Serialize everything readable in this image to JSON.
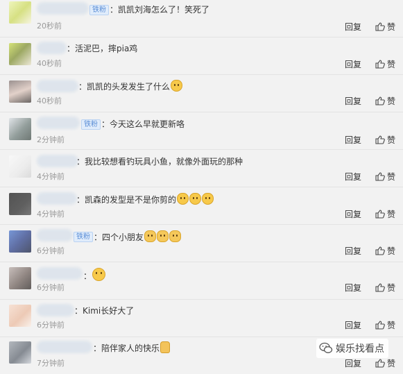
{
  "actions": {
    "reply": "回复",
    "like": "赞"
  },
  "comments": [
    {
      "badge": "铁粉",
      "text": "：凯凯刘海怎么了！笑死了",
      "emojis": [],
      "time": "20秒前"
    },
    {
      "badge": "",
      "text": "：活泥巴，摔pia鸡",
      "emojis": [],
      "time": "40秒前"
    },
    {
      "badge": "",
      "text": "：凯凯的头发发生了什么",
      "emojis": [
        "cat"
      ],
      "time": "40秒前"
    },
    {
      "badge": "铁粉",
      "text": "：今天这么早就更新咯",
      "emojis": [],
      "time": "2分钟前"
    },
    {
      "badge": "",
      "text": "：我比较想看钓玩具小鱼，就像外面玩的那种",
      "emojis": [],
      "time": "4分钟前"
    },
    {
      "badge": "",
      "text": "：凯森的发型是不是你剪的",
      "emojis": [
        "cat",
        "cat",
        "cat"
      ],
      "time": "4分钟前"
    },
    {
      "badge": "铁粉",
      "text": "：四个小朋友",
      "emojis": [
        "hand",
        "hand",
        "hand"
      ],
      "time": "6分钟前"
    },
    {
      "badge": "",
      "text": "：",
      "emojis": [
        "smile"
      ],
      "time": "6分钟前"
    },
    {
      "badge": "",
      "text": "：Kimi长好大了",
      "emojis": [],
      "time": "6分钟前"
    },
    {
      "badge": "",
      "text": "：陪伴家人的快乐",
      "emojis": [
        "thumb"
      ],
      "time": "7分钟前"
    }
  ],
  "watermark": "娱乐找看点"
}
